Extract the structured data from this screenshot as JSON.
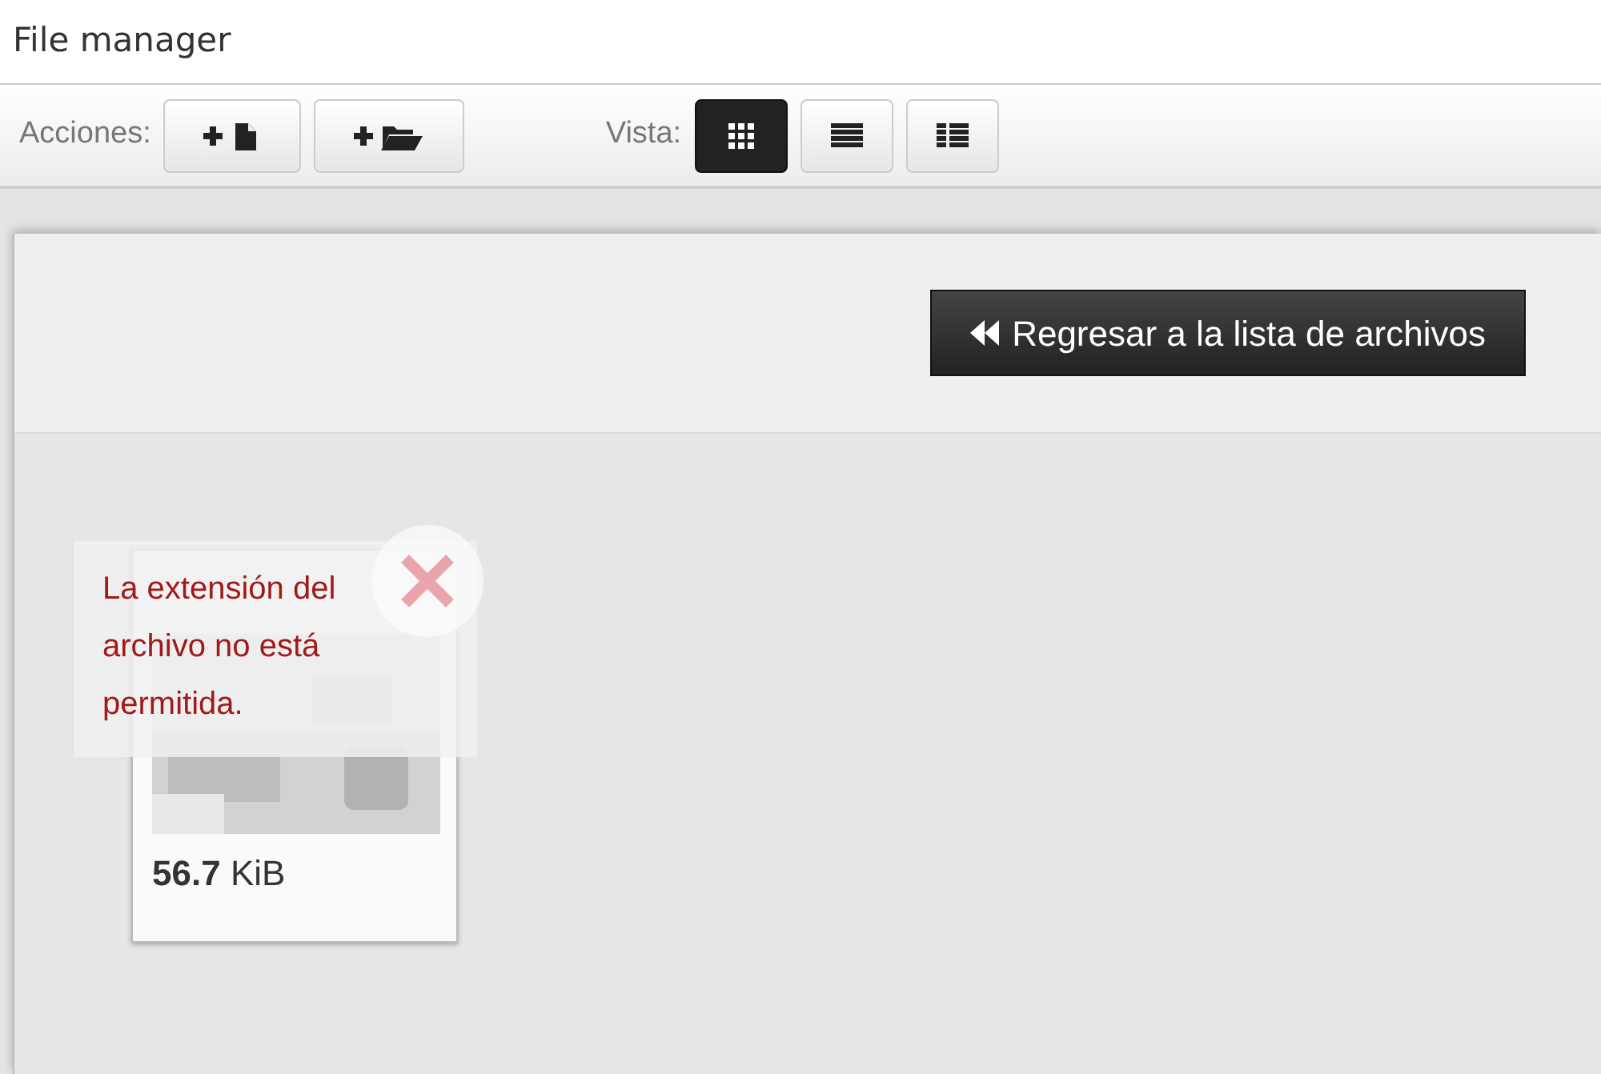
{
  "window": {
    "title": "File manager"
  },
  "toolbar": {
    "actions_label": "Acciones:",
    "actions": [
      {
        "kind": "new-file"
      },
      {
        "kind": "new-folder"
      }
    ],
    "view_label": "Vista:",
    "views": [
      {
        "kind": "grid",
        "selected": true
      },
      {
        "kind": "list",
        "selected": false
      },
      {
        "kind": "detail",
        "selected": false
      }
    ]
  },
  "back_button": {
    "label": "Regresar a la lista de archivos"
  },
  "files": [
    {
      "size_value": "56.7",
      "size_unit": "KiB",
      "error": "La extensión del archivo no está permitida."
    }
  ]
}
